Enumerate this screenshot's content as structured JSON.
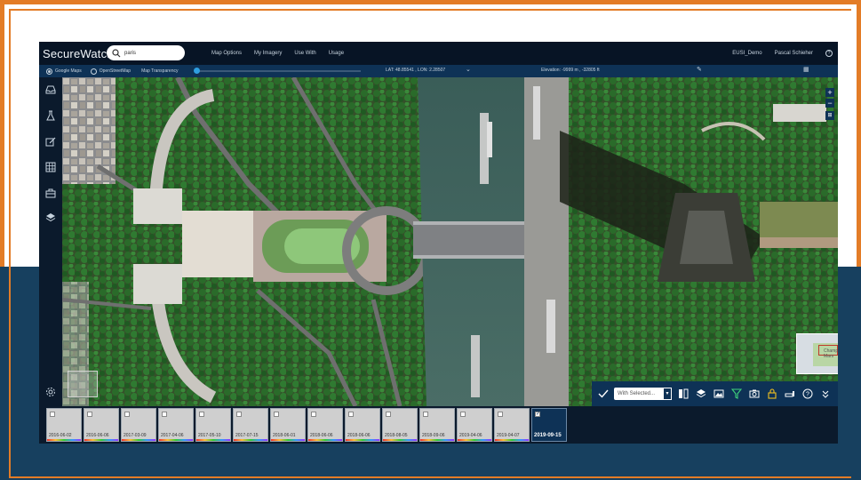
{
  "app": {
    "title": "SecureWatch",
    "search_value": "paris",
    "nav": [
      "Map Options",
      "My Imagery",
      "Use With",
      "Usage"
    ],
    "user_account": "EUSI_Demo",
    "user_name": "Pascal Schieher"
  },
  "subbar": {
    "basemap_google": "Google Maps",
    "basemap_osm": "OpenStreetMap",
    "transparency_label": "Map Transparency",
    "coordinates": "LAT: 48.85541 , LON: 2.28507",
    "elevation": "Elevation: -9999 m , -32805 ft"
  },
  "map": {
    "minimap_label": "Champ de Mars"
  },
  "toolbar": {
    "select_label": "With Selected..."
  },
  "thumbnails": [
    {
      "date": "2016-06-02",
      "checked": false
    },
    {
      "date": "2016-06-06",
      "checked": false
    },
    {
      "date": "2017-03-09",
      "checked": false
    },
    {
      "date": "2017-04-06",
      "checked": false
    },
    {
      "date": "2017-05-10",
      "checked": false
    },
    {
      "date": "2017-07-15",
      "checked": false
    },
    {
      "date": "2018-06-01",
      "checked": false
    },
    {
      "date": "2018-06-06",
      "checked": false
    },
    {
      "date": "2018-06-06",
      "checked": false
    },
    {
      "date": "2018-08-05",
      "checked": false
    },
    {
      "date": "2018-09-06",
      "checked": false
    },
    {
      "date": "2019-04-06",
      "checked": false
    },
    {
      "date": "2019-04-07",
      "checked": false
    },
    {
      "date": "2019-09-15",
      "checked": true
    }
  ],
  "colors": {
    "frame_orange": "#e37c27",
    "frame_blue": "#17405f",
    "topbar": "#071425",
    "subbar": "#0e3256",
    "accent": "#2f9fe0",
    "filter_icon": "#3fd17a",
    "lock_icon": "#f0c020"
  }
}
